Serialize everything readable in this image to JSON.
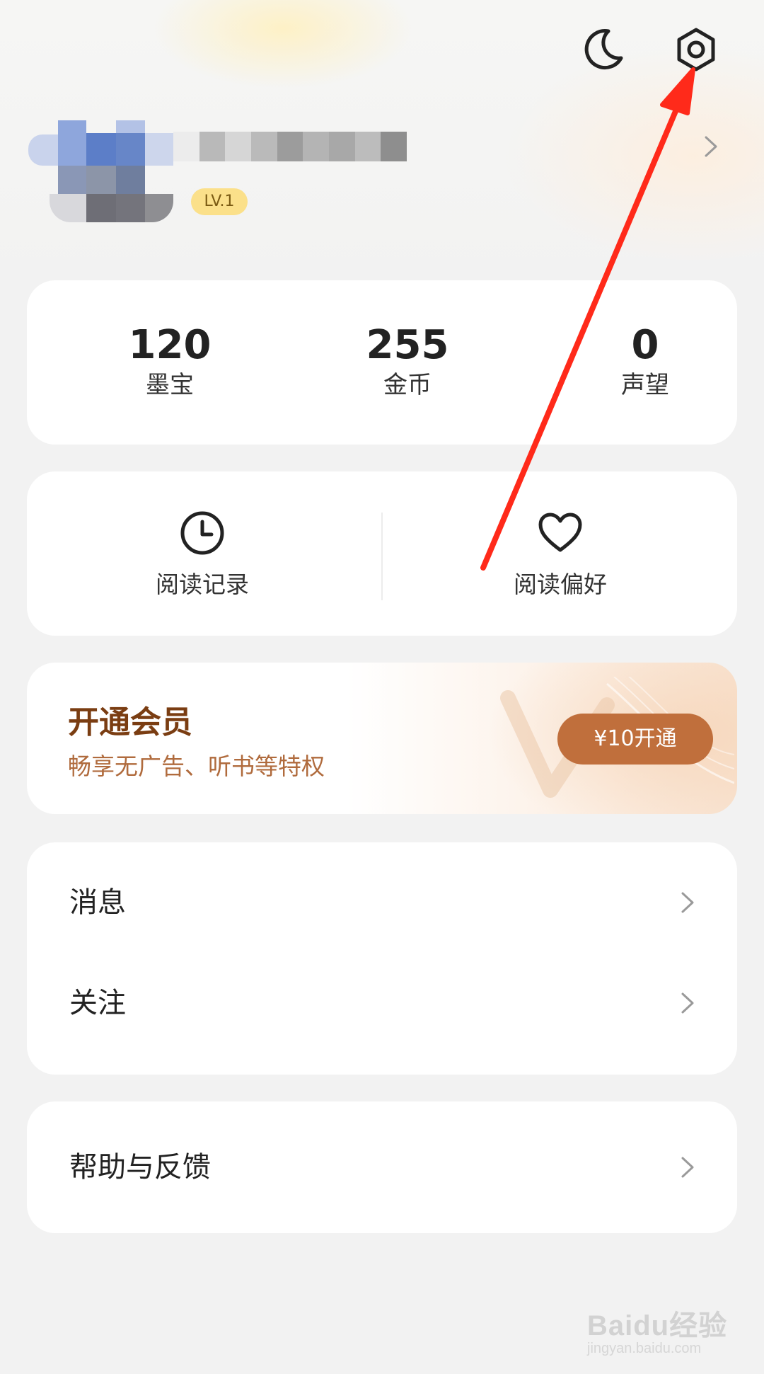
{
  "profile": {
    "level_badge": "LV.1"
  },
  "stats": [
    {
      "value": "120",
      "label": "墨宝"
    },
    {
      "value": "255",
      "label": "金币"
    },
    {
      "value": "0",
      "label": "声望"
    }
  ],
  "quick_actions": [
    {
      "label": "阅读记录",
      "icon": "clock-icon"
    },
    {
      "label": "阅读偏好",
      "icon": "heart-icon"
    }
  ],
  "vip": {
    "title": "开通会员",
    "subtitle": "畅享无广告、听书等特权",
    "button_label": "¥10开通"
  },
  "menu": {
    "group1": [
      {
        "label": "消息"
      },
      {
        "label": "关注"
      }
    ],
    "group2": [
      {
        "label": "帮助与反馈"
      }
    ]
  },
  "watermark": {
    "main": "Baidu经验",
    "sub": "jingyan.baidu.com"
  },
  "colors": {
    "accent_vip": "#c06f3c",
    "annotation_arrow": "#ff2a1a",
    "level_badge": "#fbe08a"
  }
}
